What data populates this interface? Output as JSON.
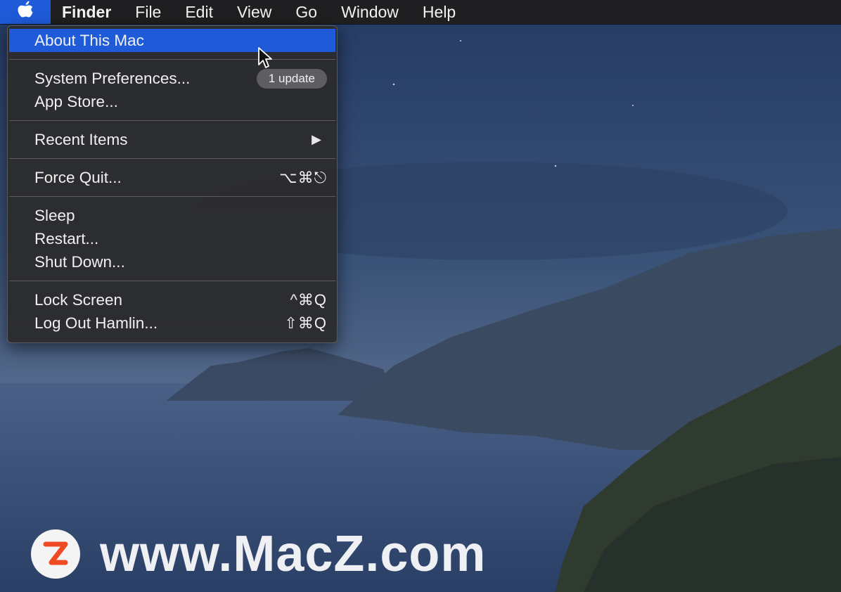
{
  "menubar": {
    "apple_icon": "apple-logo-icon",
    "items": [
      "Finder",
      "File",
      "Edit",
      "View",
      "Go",
      "Window",
      "Help"
    ]
  },
  "apple_menu": {
    "about": "About This Mac",
    "system_prefs": "System Preferences...",
    "update_badge": "1 update",
    "app_store": "App Store...",
    "recent_items": "Recent Items",
    "force_quit": "Force Quit...",
    "force_quit_shortcut": "⌥⌘⎋",
    "sleep": "Sleep",
    "restart": "Restart...",
    "shut_down": "Shut Down...",
    "lock_screen": "Lock Screen",
    "lock_screen_shortcut": "^⌘Q",
    "log_out": "Log Out Hamlin...",
    "log_out_shortcut": "⇧⌘Q"
  },
  "watermark": {
    "logo_letter": "Z",
    "text": "www.MacZ.com"
  },
  "colors": {
    "highlight": "#1f5bd8",
    "menubar": "#1f1f21",
    "menu_bg": "#2c2c2e",
    "logo_accent": "#f04a23"
  }
}
